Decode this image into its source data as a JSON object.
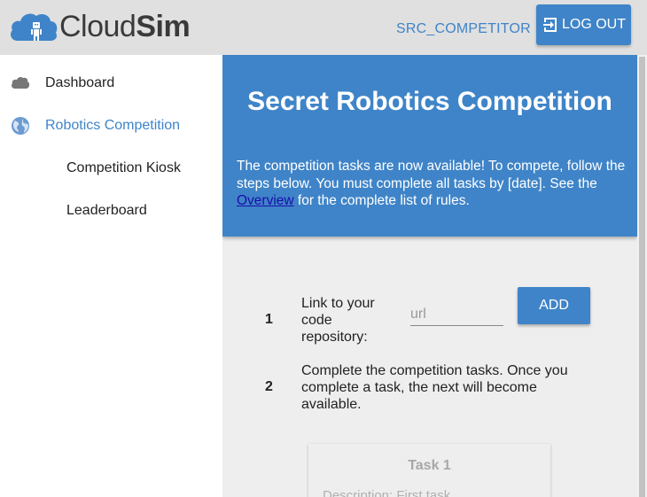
{
  "header": {
    "logo_text_light": "Cloud",
    "logo_text_bold": "Sim",
    "username": "SRC_COMPETITOR",
    "logout_label": "LOG OUT"
  },
  "sidebar": {
    "items": [
      {
        "label": "Dashboard",
        "icon": "cloud-icon"
      },
      {
        "label": "Robotics Competition",
        "icon": "globe-icon"
      },
      {
        "label": "Competition Kiosk"
      },
      {
        "label": "Leaderboard"
      }
    ]
  },
  "hero": {
    "title": "Secret Robotics Competition",
    "text_before_link": "The competition tasks are now available! To compete, follow the steps below. You must complete all tasks by [date]. See the ",
    "link_text": "Overview",
    "text_after_link": " for the complete list of rules."
  },
  "steps": [
    {
      "number": "1",
      "text": "Link to your code repository:"
    },
    {
      "number": "2",
      "text": "Complete the competition tasks. Once you complete a task, the next will become available."
    }
  ],
  "repo_input": {
    "placeholder": "url",
    "value": ""
  },
  "add_label": "ADD",
  "task": {
    "title": "Task 1",
    "description": "Description: First task"
  },
  "colors": {
    "accent": "#3f84c8",
    "topbar": "#e0e0e0",
    "main_bg": "#eeeeee"
  }
}
